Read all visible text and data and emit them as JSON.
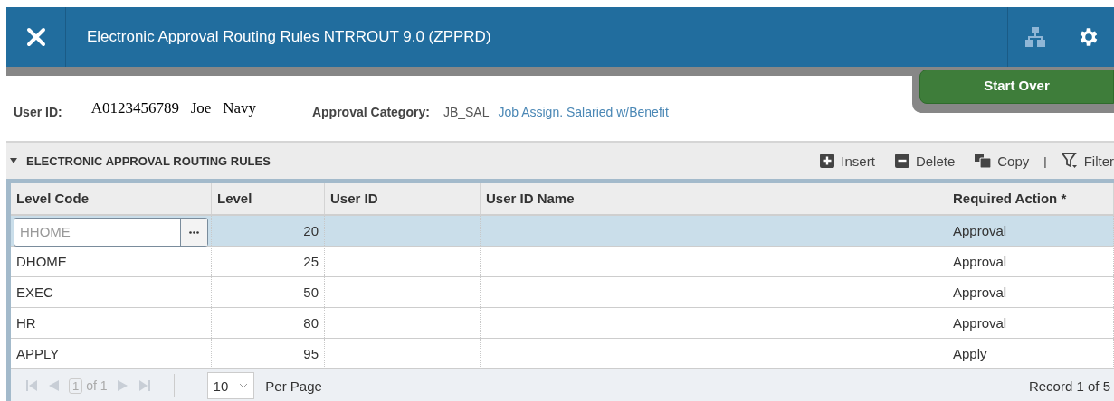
{
  "window": {
    "title": "Electronic Approval Routing Rules NTRROUT 9.0 (ZPPRD)"
  },
  "start_over": "Start Over",
  "key_block": {
    "user_id_label": "User ID:",
    "user_id_value": "A0123456789   Joe   Navy",
    "category_label": "Approval Category:",
    "category_code": "JB_SAL",
    "category_desc": "Job Assign. Salaried w/Benefit"
  },
  "section": {
    "title": "ELECTRONIC APPROVAL ROUTING RULES",
    "expanded": true,
    "tools": [
      {
        "kind": "insert",
        "label": "Insert"
      },
      {
        "kind": "delete",
        "label": "Delete"
      },
      {
        "kind": "copy",
        "label": "Copy"
      },
      {
        "kind": "separator",
        "label": "|"
      },
      {
        "kind": "filter",
        "label": "Filter"
      }
    ]
  },
  "table": {
    "columns": [
      "Level Code",
      "Level",
      "User ID",
      "User ID Name",
      "Required Action *"
    ],
    "rows": [
      {
        "selected": true,
        "cells": [
          "HHOME",
          "20",
          "",
          "",
          "Approval"
        ]
      },
      {
        "selected": false,
        "cells": [
          "DHOME",
          "25",
          "",
          "",
          "Approval"
        ]
      },
      {
        "selected": false,
        "cells": [
          "EXEC",
          "50",
          "",
          "",
          "Approval"
        ]
      },
      {
        "selected": false,
        "cells": [
          "HR",
          "80",
          "",
          "",
          "Approval"
        ]
      },
      {
        "selected": false,
        "cells": [
          "APPLY",
          "95",
          "",
          "",
          "Apply"
        ]
      }
    ]
  },
  "pager": {
    "page": "1",
    "of": "of 1",
    "per_page": "10",
    "per_page_label": "Per Page",
    "record": "Record 1 of 5"
  }
}
